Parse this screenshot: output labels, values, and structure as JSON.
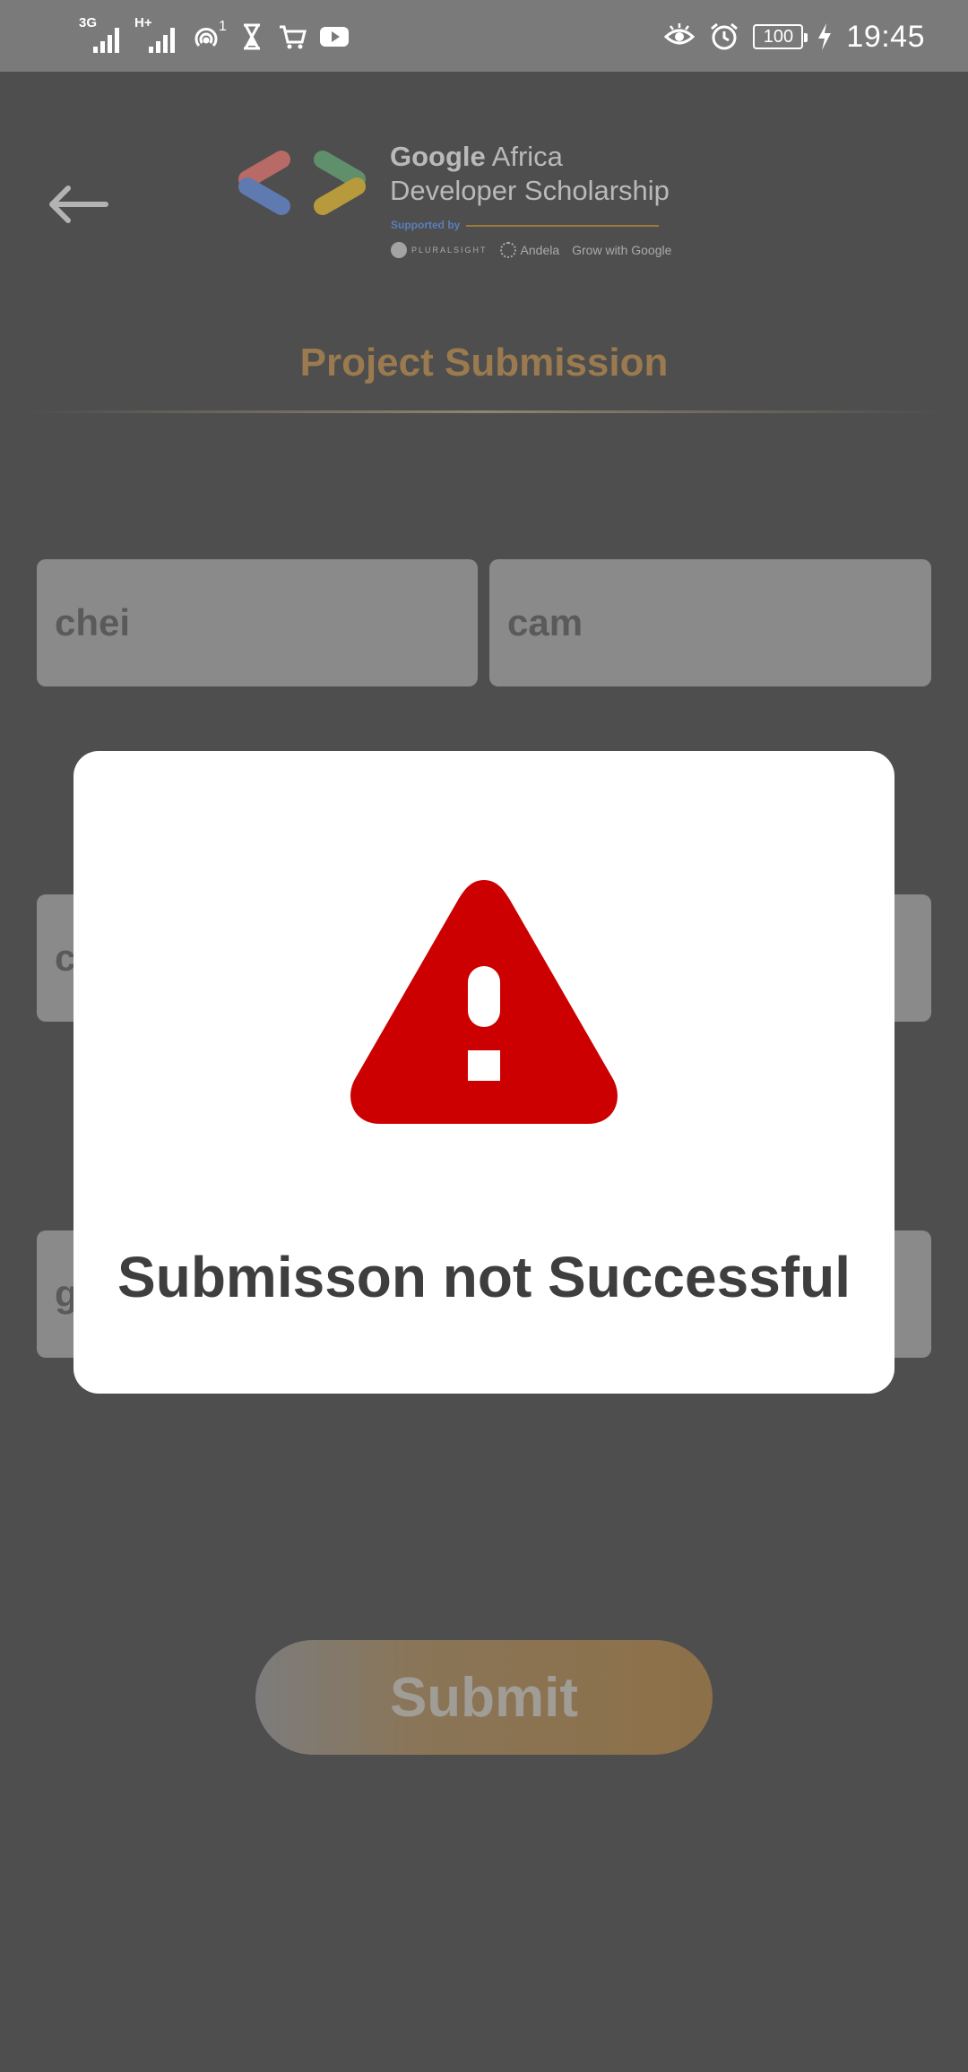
{
  "status_bar": {
    "signal1_tag": "3G",
    "signal2_tag": "H+",
    "hotspot_count": "1",
    "battery": "100",
    "time": "19:45",
    "icons": [
      "signal-icon",
      "signal-icon",
      "hotspot-icon",
      "hourglass-icon",
      "cart-icon",
      "youtube-icon",
      "eye-icon",
      "alarm-icon",
      "battery-icon",
      "charging-icon"
    ]
  },
  "header": {
    "logo_line1_bold": "Google",
    "logo_line1_rest": " Africa",
    "logo_line2": "Developer Scholarship",
    "supported_by": "Supported by",
    "partners": [
      "PLURALSIGHT",
      "Andela",
      "Grow with Google"
    ]
  },
  "page": {
    "title": "Project Submission"
  },
  "form": {
    "first_name": "chei",
    "last_name": "cam",
    "email_partial": "c",
    "github_partial": "g",
    "submit_label": "Submit"
  },
  "dialog": {
    "message": "Submisson not Successful",
    "icon": "warning-icon",
    "icon_color": "#cc0000"
  },
  "colors": {
    "accent": "#9a7a4e",
    "overlay_background": "#4e4e4e",
    "dialog_background": "#ffffff"
  }
}
